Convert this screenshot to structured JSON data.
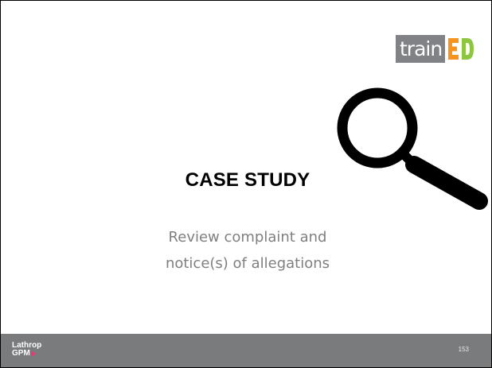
{
  "slide": {
    "title": "CASE STUDY",
    "subtitle_line1": "Review complaint and",
    "subtitle_line2": "notice(s) of allegations",
    "page_number": "153"
  },
  "logos": {
    "brand_text": "train",
    "brand_text_suffix": "ED",
    "footer_line1": "Lathrop",
    "footer_line2": "GPM"
  },
  "icons": {
    "magnifier": "magnifying-glass-icon",
    "footer_arrow": "arrow-icon"
  },
  "colors": {
    "footer_bar": "#7a7b7d",
    "logo_gray": "#808285",
    "logo_ed_orange": "#f7941d",
    "logo_ed_green": "#8dc63f",
    "subtitle": "#7f7f7f",
    "footer_arrow": "#e8397a"
  }
}
